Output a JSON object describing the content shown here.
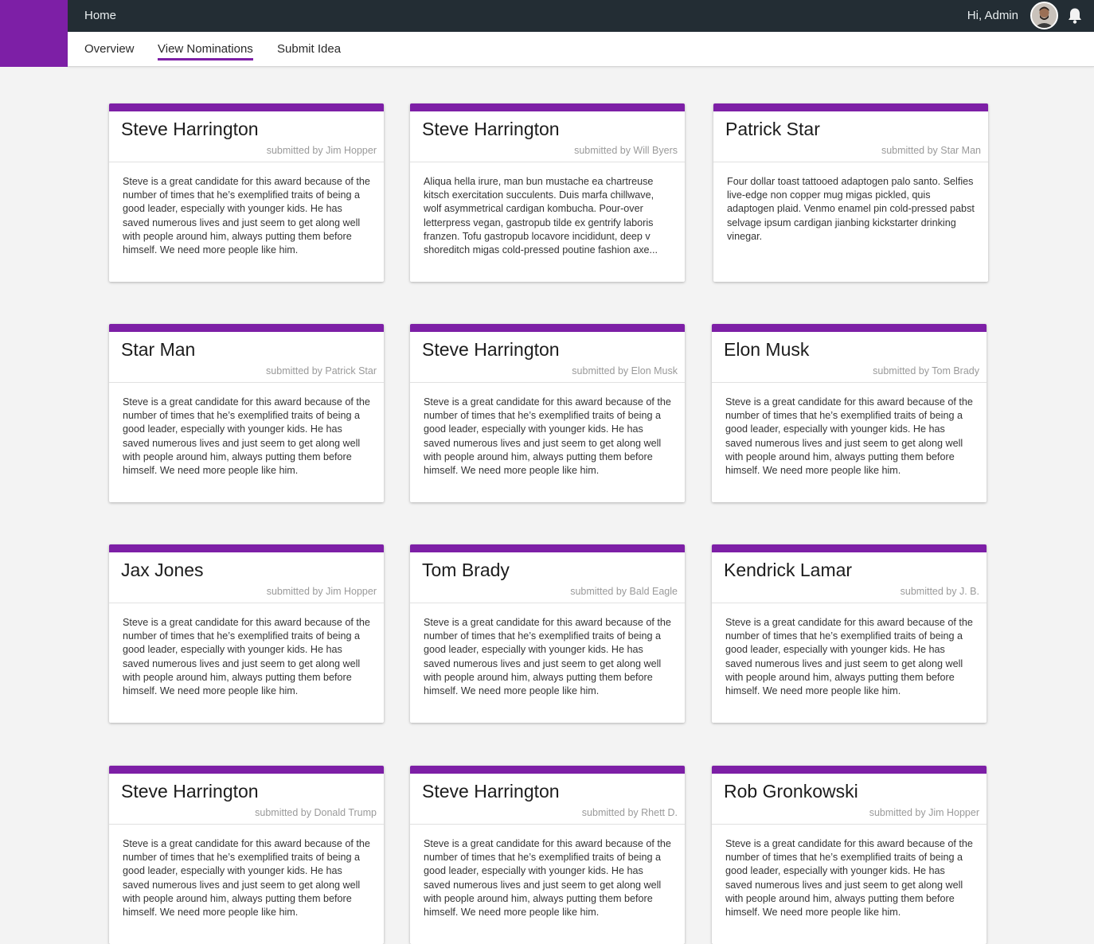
{
  "header": {
    "home_label": "Home",
    "greeting": "Hi, Admin"
  },
  "tabs": [
    "Overview",
    "View Nominations",
    "Submit Idea"
  ],
  "active_tab": "View Nominations",
  "cards": [
    {
      "name": "Steve Harrington",
      "submitted_by": "submitted by Jim Hopper",
      "text": "Steve is a great candidate for this award because of the number of times that he’s exemplified traits of being a good leader, especially with younger kids. He has saved numerous lives and just seem to get along well with people around him, always putting them before himself. We need more people like him."
    },
    {
      "name": "Steve Harrington",
      "submitted_by": "submitted by Will Byers",
      "text": "Aliqua hella irure, man bun mustache ea chartreuse kitsch exercitation succulents. Duis marfa chillwave, wolf asymmetrical cardigan kombucha. Pour-over letterpress vegan, gastropub tilde ex gentrify laboris franzen. Tofu gastropub locavore incididunt, deep v shoreditch migas cold-pressed poutine fashion axe..."
    },
    {
      "name": "Patrick Star",
      "submitted_by": "submitted by Star Man",
      "text": "Four dollar toast tattooed adaptogen palo santo. Selfies live-edge non copper mug migas pickled, quis adaptogen plaid. Venmo enamel pin cold-pressed pabst selvage ipsum cardigan jianbing kickstarter drinking vinegar."
    },
    {
      "name": "Star Man",
      "submitted_by": "submitted by Patrick Star",
      "text": "Steve is a great candidate for this award because of the number of times that he’s exemplified traits of being a good leader, especially with younger kids. He has saved numerous lives and just seem to get along well with people around him, always putting them before himself. We need more people like him."
    },
    {
      "name": "Steve Harrington",
      "submitted_by": "submitted by Elon Musk",
      "text": "Steve is a great candidate for this award because of the number of times that he’s exemplified traits of being a good leader, especially with younger kids. He has saved numerous lives and just seem to get along well with people around him, always putting them before himself. We need more people like him."
    },
    {
      "name": "Elon Musk",
      "submitted_by": "submitted by Tom Brady",
      "text": "Steve is a great candidate for this award because of the number of times that he’s exemplified traits of being a good leader, especially with younger kids. He has saved numerous lives and just seem to get along well with people around him, always putting them before himself. We need more people like him."
    },
    {
      "name": "Jax Jones",
      "submitted_by": "submitted by Jim Hopper",
      "text": "Steve is a great candidate for this award because of the number of times that he’s exemplified traits of being a good leader, especially with younger kids. He has saved numerous lives and just seem to get along well with people around him, always putting them before himself. We need more people like him."
    },
    {
      "name": "Tom Brady",
      "submitted_by": "submitted by Bald Eagle",
      "text": "Steve is a great candidate for this award because of the number of times that he’s exemplified traits of being a good leader, especially with younger kids. He has saved numerous lives and just seem to get along well with people around him, always putting them before himself. We need more people like him."
    },
    {
      "name": "Kendrick Lamar",
      "submitted_by": "submitted by J. B.",
      "text": "Steve is a great candidate for this award because of the number of times that he’s exemplified traits of being a good leader, especially with younger kids. He has saved numerous lives and just seem to get along well with people around him, always putting them before himself. We need more people like him."
    },
    {
      "name": "Steve Harrington",
      "submitted_by": "submitted by Donald Trump",
      "text": "Steve is a great candidate for this award because of the number of times that he’s exemplified traits of being a good leader, especially with younger kids. He has saved numerous lives and just seem to get along well with people around him, always putting them before himself. We need more people like him."
    },
    {
      "name": "Steve Harrington",
      "submitted_by": "submitted by Rhett D.",
      "text": "Steve is a great candidate for this award because of the number of times that he’s exemplified traits of being a good leader, especially with younger kids. He has saved numerous lives and just seem to get along well with people around him, always putting them before himself. We need more people like him."
    },
    {
      "name": "Rob Gronkowski",
      "submitted_by": "submitted by Jim Hopper",
      "text": "Steve is a great candidate for this award because of the number of times that he’s exemplified traits of being a good leader, especially with younger kids. He has saved numerous lives and just seem to get along well with people around him, always putting them before himself. We need more people like him."
    }
  ],
  "colors": {
    "brand": "#7d1fa6",
    "topbar": "#232d34",
    "background": "#f3f3f3"
  }
}
